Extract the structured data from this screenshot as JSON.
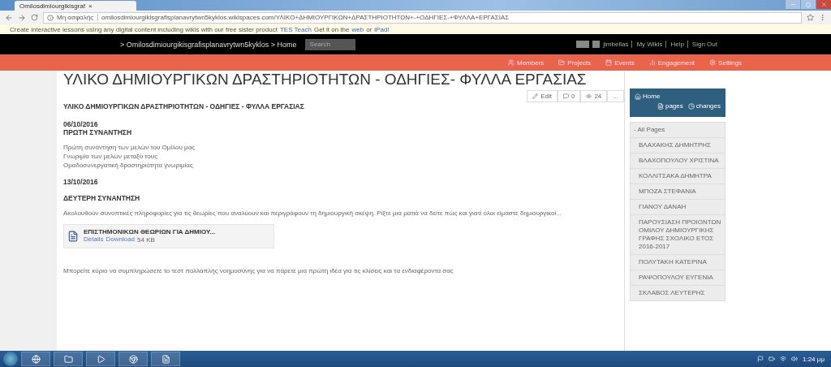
{
  "browser": {
    "tab": {
      "title": "Omilosdimiourgikisgraf",
      "close": "×"
    },
    "security": "Μη ασφαλής",
    "url": "omilosdimiourgikisgrafisplanavrytwn5kyklos.wikispaces.com/ΥΛΙΚΟ+ΔΗΜΙΟΥΡΓΙΚΩΝ+ΔΡΑΣΤΗΡΙΟΤΗΤΩΝ+-+ΟΔΗΓΙΕΣ-+ΦΥΛΛΑ+ΕΡΓΑΣΙΑΣ"
  },
  "banner": {
    "text": "Create interactive lessons using any digital content including wikis with our free sister product",
    "link": "TES Teach",
    "text2": "Get it on the",
    "link2": "web",
    "text3": "or",
    "link3": "iPad!"
  },
  "topbar": {
    "breadcrumb": "> Omilosdimiourgikisgrafisplanavrytwn5kyklos > Home",
    "search_placeholder": "Search",
    "user_links": [
      "jimbellas",
      "My Wikis",
      "Help",
      "Sign Out"
    ]
  },
  "nav": [
    "Members",
    "Projects",
    "Events",
    "Engagement",
    "Settings"
  ],
  "page": {
    "title": "ΥΛΙΚΟ ΔΗΜΙΟΥΡΓΙΚΩΝ ΔΡΑΣΤΗΡΙΟΤΗΤΩΝ - ΟΔΗΓΙΕΣ- ΦΥΛΛΑ ΕΡΓΑΣΙΑΣ",
    "actions": {
      "edit": "Edit",
      "comments": "0",
      "views": "24",
      "more": "..."
    },
    "heading": "ΥΛΙΚΟ ΔΗΜΙΟΥΡΓΙΚΩΝ ΔΡΑΣΤΗΡΙΟΤΗΤΩΝ - ΟΔΗΓΙΕΣ - ΦΥΛΛΑ ΕΡΓΑΣΙΑΣ",
    "sections": [
      {
        "date": "06/10/2016",
        "title": "ΠΡΩΤΗ ΣΥΝΑΝΤΗΣΗ",
        "lines": [
          "Πρώτη συνάντηση των μελών του Ομίλου μας",
          "Γνωριμία των μελών μεταξύ τους",
          "Ομαδοσυνεργατική δραστηριότητα γνωριμίας"
        ]
      },
      {
        "date": "13/10/2016",
        "title": "ΔΕΥΤΕΡΗ ΣΥΝΑΝΤΗΣΗ",
        "lines": [
          "Ακολουθούν συνοπτικές πληροφορίες για τις θεωρίες που αναλύουν και περιγράφουν τη δημιουργική σκέψη. Ρίξτε μια ματιά να δείτε πώς και γιατί όλοι είμαστε δημιουργικοί..."
        ],
        "file": {
          "name": "ΕΠΙΣΤΗΜΟΝΙΚΩΝ ΘΕΩΡΙΩΝ ΓΙΑ ΔΗΜΙΟΥ...",
          "details": "Details",
          "download": "Download",
          "size": "54 KB"
        },
        "footer": "Μπορείτε κύριο να συμπληρώσετε το τεστ πολλαπλής νοημοσύνης για να πάρετε μια πρώτη ιδέα για τις κλίσεις και τα ενδιαφέροντα σας"
      }
    ]
  },
  "sidebar": {
    "home": "Home",
    "pages": "pages",
    "changes": "changes",
    "all_pages": "- All Pages",
    "items": [
      "ΒΛΑΧΑΚΗΣ ΔΗΜΗΤΡΗΣ",
      "ΒΛΑΧΟΠΟΥΛΟΥ ΧΡΙΣΤΙΝΑ",
      "ΚΟΛΛΙΤΣΑΚΑ ΔΗΜΗΤΡΑ",
      "ΜΠΟΖΑ ΣΤΕΦΑΝΙΑ",
      "ΓΙΑΝΟΥ ΔΑΝΑΗ",
      "ΠΑΡΟΥΣΙΑΣΗ ΠΡΟΙΟΝΤΩΝ ΟΜΙΛΟΥ ΔΗΜΙΟΥΡΓΙΚΗΣ ΓΡΑΦΗΣ ΣΧΟΛΙΚΟ ΕΤΟΣ 2016-2017",
      "ΠΟΛΥΤΑΚΗ ΚΑΤΕΡΙΝΑ",
      "ΡΑΨΟΠΟΥΛΟΥ ΕΥΓΕΝΙΑ",
      "ΣΚΛΑΒΟΣ ΛΕΥΤΕΡΗΣ"
    ]
  },
  "taskbar": {
    "time": "1:24 μμ"
  }
}
